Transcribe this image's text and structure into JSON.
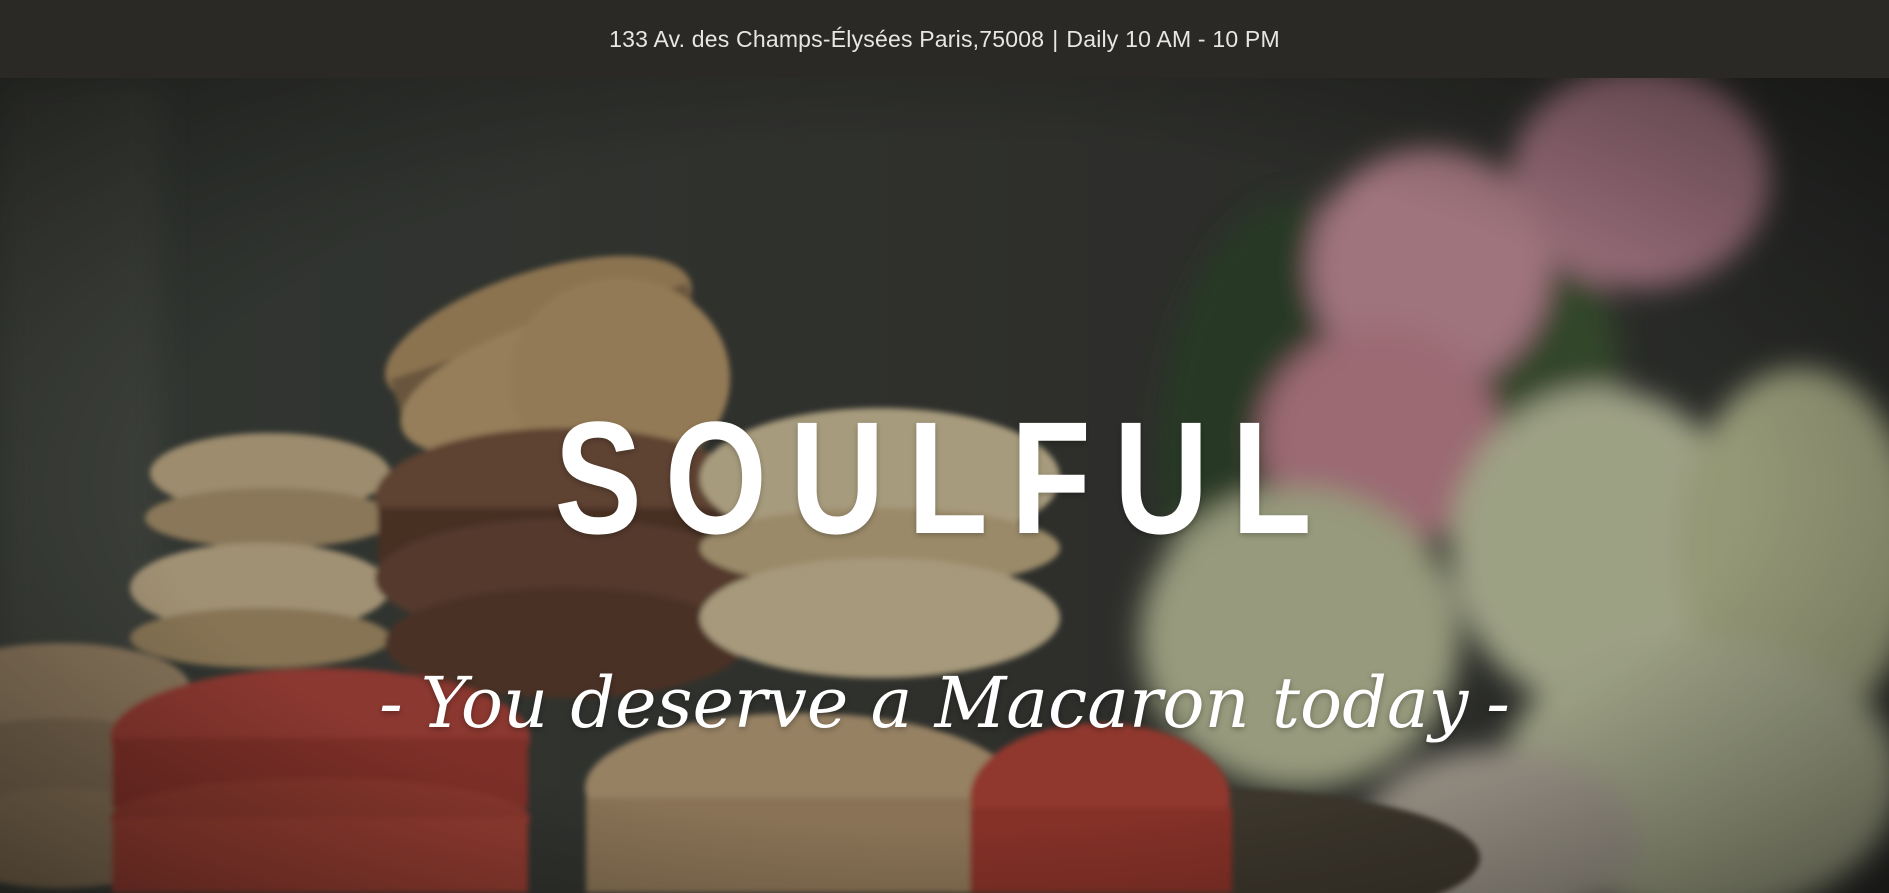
{
  "topbar": {
    "address": "133 Av. des Champs-Élysées Paris,75008",
    "separator": "|",
    "hours": "Daily 10 AM - 10 PM"
  },
  "hero": {
    "title": "SOULFUL",
    "tagline_prefix": "-",
    "tagline": "You deserve a Macaron today",
    "tagline_suffix": "-",
    "background_image": "macarons-and-flowers-photo"
  },
  "colors": {
    "topbar_bg": "#2b2926",
    "topbar_text": "#e8e6e2",
    "hero_text": "#ffffff"
  }
}
